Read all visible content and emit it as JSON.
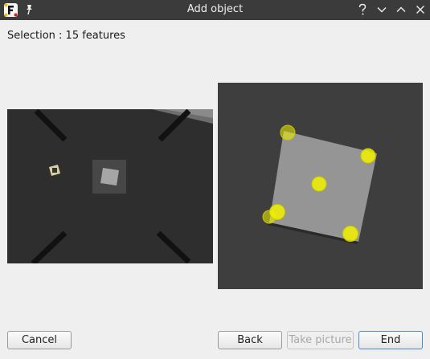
{
  "window": {
    "title": "Add object",
    "controls": [
      "help-icon",
      "minimize-icon",
      "maximize-icon",
      "close-icon"
    ]
  },
  "selection_text": "Selection : 15 features",
  "buttons": {
    "cancel": "Cancel",
    "back": "Back",
    "take_picture": "Take picture",
    "end": "End"
  },
  "colors": {
    "titlebar": "#3b3b3b",
    "feature_marker": "#f2f200",
    "default_button_border": "#4a8ad2"
  }
}
